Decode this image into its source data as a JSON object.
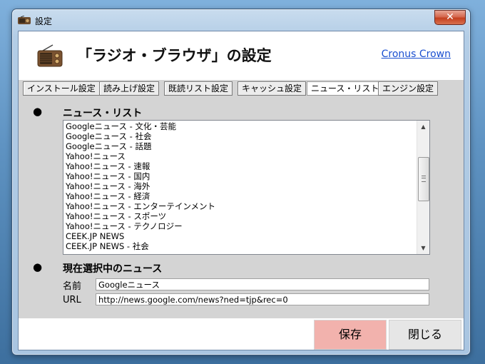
{
  "window": {
    "title": "設定",
    "close_glyph": "✕"
  },
  "header": {
    "title": "「ラジオ・ブラウザ」の設定",
    "link": "Cronus Crown"
  },
  "tabs": [
    {
      "label": "インストール設定"
    },
    {
      "label": "読み上げ設定"
    },
    {
      "label": "既読リスト設定"
    },
    {
      "label": "キャッシュ設定"
    },
    {
      "label": "ニュース・リスト",
      "active": true
    },
    {
      "label": "エンジン設定"
    }
  ],
  "news_section": {
    "bullet": "●",
    "title": "ニュース・リスト",
    "items": [
      "Googleニュース - 文化・芸能",
      "Googleニュース - 社会",
      "Googleニュース - 話題",
      "Yahoo!ニュース",
      "Yahoo!ニュース - 速報",
      "Yahoo!ニュース - 国内",
      "Yahoo!ニュース - 海外",
      "Yahoo!ニュース - 経済",
      "Yahoo!ニュース - エンターテインメント",
      "Yahoo!ニュース - スポーツ",
      "Yahoo!ニュース - テクノロジー",
      "CEEK.JP NEWS",
      "CEEK.JP NEWS - 社会"
    ]
  },
  "current_section": {
    "bullet": "●",
    "title": "現在選択中のニュース",
    "name_label": "名前",
    "name_value": "Googleニュース",
    "url_label": "URL",
    "url_value": "http://news.google.com/news?ned=tjp&rec=0"
  },
  "footer": {
    "save_label": "保存",
    "close_label": "閉じる"
  },
  "colors": {
    "save_button": "#f2b2ad",
    "link": "#1a4fd0",
    "close_button": "#c4401f"
  }
}
